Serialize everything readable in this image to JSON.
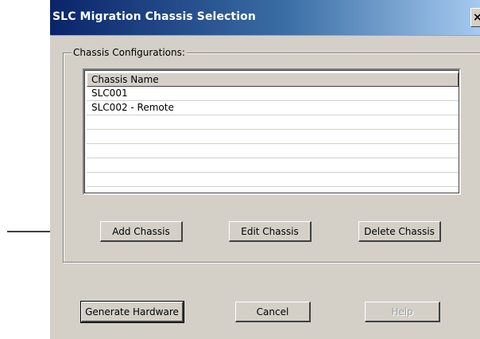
{
  "window": {
    "title": "SLC Migration Chassis Selection",
    "close_glyph": "×"
  },
  "group": {
    "label": "Chassis Configurations:"
  },
  "list": {
    "column_header": "Chassis Name",
    "rows": [
      "SLC001",
      "SLC002 - Remote",
      "",
      "",
      "",
      "",
      "",
      ""
    ]
  },
  "group_buttons": {
    "add": "Add Chassis",
    "edit": "Edit Chassis",
    "delete": "Delete Chassis"
  },
  "footer_buttons": {
    "generate": "Generate Hardware",
    "cancel": "Cancel",
    "help": "Help"
  },
  "annotation": {
    "arrow_target": "Add Chassis",
    "arrow_color": "#000000"
  }
}
